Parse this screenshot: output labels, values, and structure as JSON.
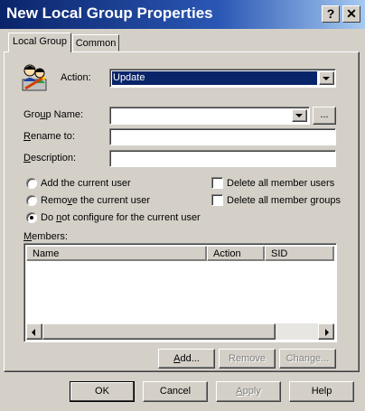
{
  "window": {
    "title": "New Local Group Properties",
    "help_button": "?",
    "close_button": "✕"
  },
  "tabs": [
    {
      "label": "Local Group"
    },
    {
      "label": "Common"
    }
  ],
  "action": {
    "label": "Action:",
    "selected": "Update"
  },
  "fields": {
    "group_name_label": "Group Name:",
    "group_name_value": "",
    "browse_label": "...",
    "rename_label": "Rename to:",
    "rename_value": "",
    "description_label": "Description:",
    "description_value": ""
  },
  "current_user_options": [
    {
      "label": "Add the current user",
      "selected": false
    },
    {
      "label": "Remove the current user",
      "selected": false
    },
    {
      "label": "Do not configure for the current user",
      "selected": true
    }
  ],
  "member_options": [
    {
      "label": "Delete all member users",
      "checked": false
    },
    {
      "label": "Delete all member groups",
      "checked": false
    }
  ],
  "members": {
    "label": "Members:",
    "columns": [
      "Name",
      "Action",
      "SID"
    ],
    "rows": []
  },
  "member_buttons": {
    "add": "Add...",
    "remove": "Remove",
    "change": "Change..."
  },
  "dialog_buttons": {
    "ok": "OK",
    "cancel": "Cancel",
    "apply": "Apply",
    "help": "Help"
  }
}
